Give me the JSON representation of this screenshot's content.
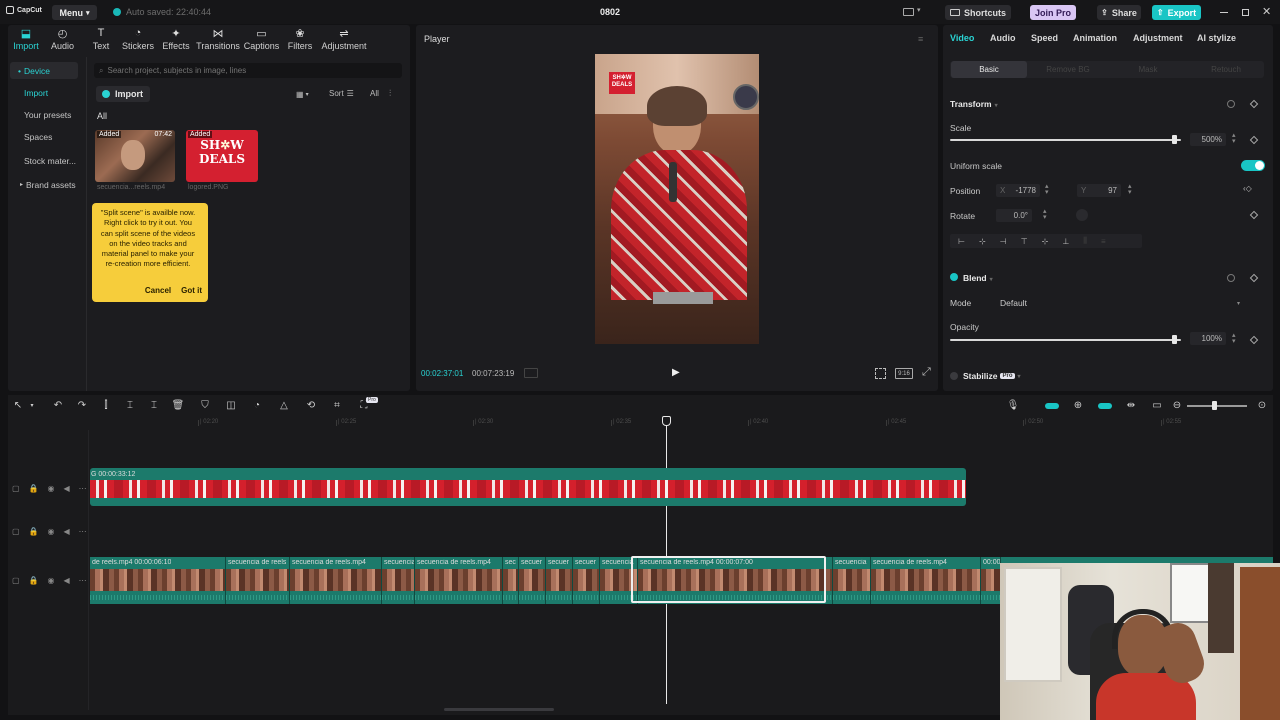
{
  "app": {
    "logo_text": "CapCut",
    "menu_label": "Menu",
    "autosave_text": "Auto saved: 22:40:44",
    "project_title": "0802",
    "shortcuts_label": "Shortcuts",
    "join_pro_label": "Join Pro",
    "share_label": "Share",
    "export_label": "Export"
  },
  "toolbar": {
    "items": [
      {
        "label": "Import",
        "icon": "import-icon"
      },
      {
        "label": "Audio",
        "icon": "audio-icon"
      },
      {
        "label": "Text",
        "icon": "text-icon"
      },
      {
        "label": "Stickers",
        "icon": "stickers-icon"
      },
      {
        "label": "Effects",
        "icon": "effects-icon"
      },
      {
        "label": "Transitions",
        "icon": "transitions-icon"
      },
      {
        "label": "Captions",
        "icon": "captions-icon"
      },
      {
        "label": "Filters",
        "icon": "filters-icon"
      },
      {
        "label": "Adjustment",
        "icon": "adjustment-icon"
      }
    ]
  },
  "media": {
    "sidebar": [
      "Device",
      "Import",
      "Your presets",
      "Spaces",
      "Stock mater...",
      "Brand assets"
    ],
    "search_placeholder": "Search project, subjects in image, lines",
    "import_label": "Import",
    "sort_label": "Sort",
    "all_label": "All",
    "filter_all": "All",
    "thumbs": [
      {
        "tag": "Added",
        "duration": "07:42",
        "name": "secuencia...reels.mp4"
      },
      {
        "tag": "Added",
        "duration": "",
        "name": "logored.PNG"
      }
    ],
    "tooltip_text": "\"Split scene\" is availble now. Right click to try it out. You can split scene of the videos on the video tracks and material panel to make your re-creation more efficient.",
    "tooltip_cancel": "Cancel",
    "tooltip_gotit": "Got it"
  },
  "player": {
    "title": "Player",
    "current_time": "00:02:37:01",
    "total_time": "00:07:23:19",
    "ratio_label": "9:16"
  },
  "properties": {
    "tabs": [
      "Video",
      "Audio",
      "Speed",
      "Animation",
      "Adjustment",
      "AI stylize"
    ],
    "subtabs": [
      "Basic",
      "Remove BG",
      "Mask",
      "Retouch"
    ],
    "transform_title": "Transform",
    "scale_label": "Scale",
    "scale_value": "500%",
    "scale_fraction": 0.97,
    "uniform_scale_label": "Uniform scale",
    "position_label": "Position",
    "pos_x_label": "X",
    "pos_x_value": "-1778",
    "pos_y_label": "Y",
    "pos_y_value": "97",
    "rotate_label": "Rotate",
    "rotate_value": "0.0°",
    "blend_title": "Blend",
    "mode_label": "Mode",
    "mode_value": "Default",
    "opacity_label": "Opacity",
    "opacity_value": "100%",
    "opacity_fraction": 0.97,
    "stabilize_label": "Stabilize",
    "pro_badge": "Pro"
  },
  "timeline": {
    "ruler": [
      "02:20",
      "02:25",
      "02:30",
      "02:35",
      "02:40",
      "02:45",
      "02:50",
      "02:55"
    ],
    "overlay_label": "G  00:00:33:12",
    "main_clips": [
      "de reels.mp4  00:00:06:10",
      "secuencia de reels",
      "secuencia de reels.mp4",
      "secuencia",
      "secuencia de reels.mp4",
      "sec",
      "secuer",
      "secuer",
      "secuer",
      "secuencia",
      "secuencia de reels.mp4  00:00:07:00",
      "secuencia",
      "secuencia de reels.mp4",
      "00:00"
    ],
    "pro_badge": "Pro"
  },
  "colors": {
    "accent": "#2ad4d4",
    "overlay_track": "#1c7a6b",
    "tooltip_bg": "#f6cd3b",
    "join_pro_bg": "#d9c6f4",
    "export_bg": "#19c5c5"
  }
}
